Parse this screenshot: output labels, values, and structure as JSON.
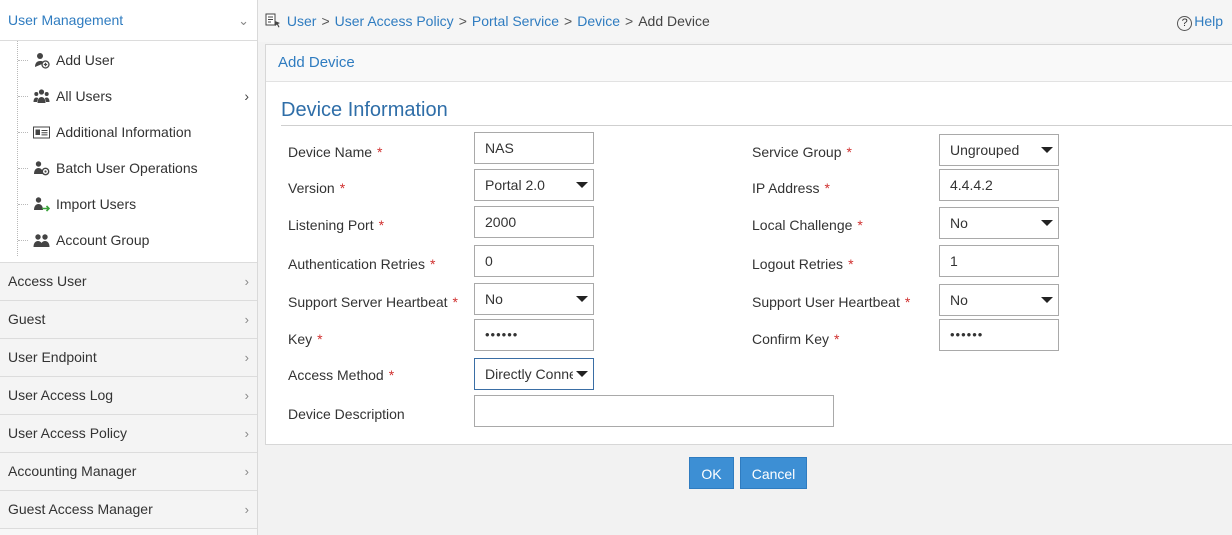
{
  "sidebar": {
    "open_section": "User Management",
    "sub_items": [
      {
        "label": "Add User",
        "icon": "user-add-icon"
      },
      {
        "label": "All Users",
        "icon": "users-group-icon",
        "has_arrow": true
      },
      {
        "label": "Additional Information",
        "icon": "id-card-icon"
      },
      {
        "label": "Batch User Operations",
        "icon": "users-batch-icon"
      },
      {
        "label": "Import Users",
        "icon": "user-import-icon"
      },
      {
        "label": "Account Group",
        "icon": "account-group-icon"
      }
    ],
    "sections": [
      "Access User",
      "Guest",
      "User Endpoint",
      "User Access Log",
      "User Access Policy",
      "Accounting Manager",
      "Guest Access Manager"
    ]
  },
  "breadcrumb": {
    "items": [
      "User",
      "User Access Policy",
      "Portal Service",
      "Device"
    ],
    "separator": ">",
    "current": "Add Device"
  },
  "help_label": "Help",
  "panel": {
    "title": "Add Device",
    "section_title": "Device Information"
  },
  "form": {
    "required_mark": "*",
    "device_name": {
      "label": "Device Name",
      "value": "NAS"
    },
    "version": {
      "label": "Version",
      "value": "Portal 2.0"
    },
    "listening_port": {
      "label": "Listening Port",
      "value": "2000"
    },
    "auth_retries": {
      "label": "Authentication Retries",
      "value": "0"
    },
    "server_heartbeat": {
      "label": "Support Server Heartbeat",
      "value": "No"
    },
    "key": {
      "label": "Key",
      "value": "••••••"
    },
    "access_method": {
      "label": "Access Method",
      "value": "Directly Connected"
    },
    "device_description": {
      "label": "Device Description",
      "value": ""
    },
    "service_group": {
      "label": "Service Group",
      "value": "Ungrouped"
    },
    "ip_address": {
      "label": "IP Address",
      "value": "4.4.4.2"
    },
    "local_challenge": {
      "label": "Local Challenge",
      "value": "No"
    },
    "logout_retries": {
      "label": "Logout Retries",
      "value": "1"
    },
    "user_heartbeat": {
      "label": "Support User Heartbeat",
      "value": "No"
    },
    "confirm_key": {
      "label": "Confirm Key",
      "value": "••••••"
    }
  },
  "buttons": {
    "ok": "OK",
    "cancel": "Cancel"
  },
  "colors": {
    "accent": "#2f7cc0",
    "button": "#3d8fd4",
    "required": "#d0302f"
  }
}
